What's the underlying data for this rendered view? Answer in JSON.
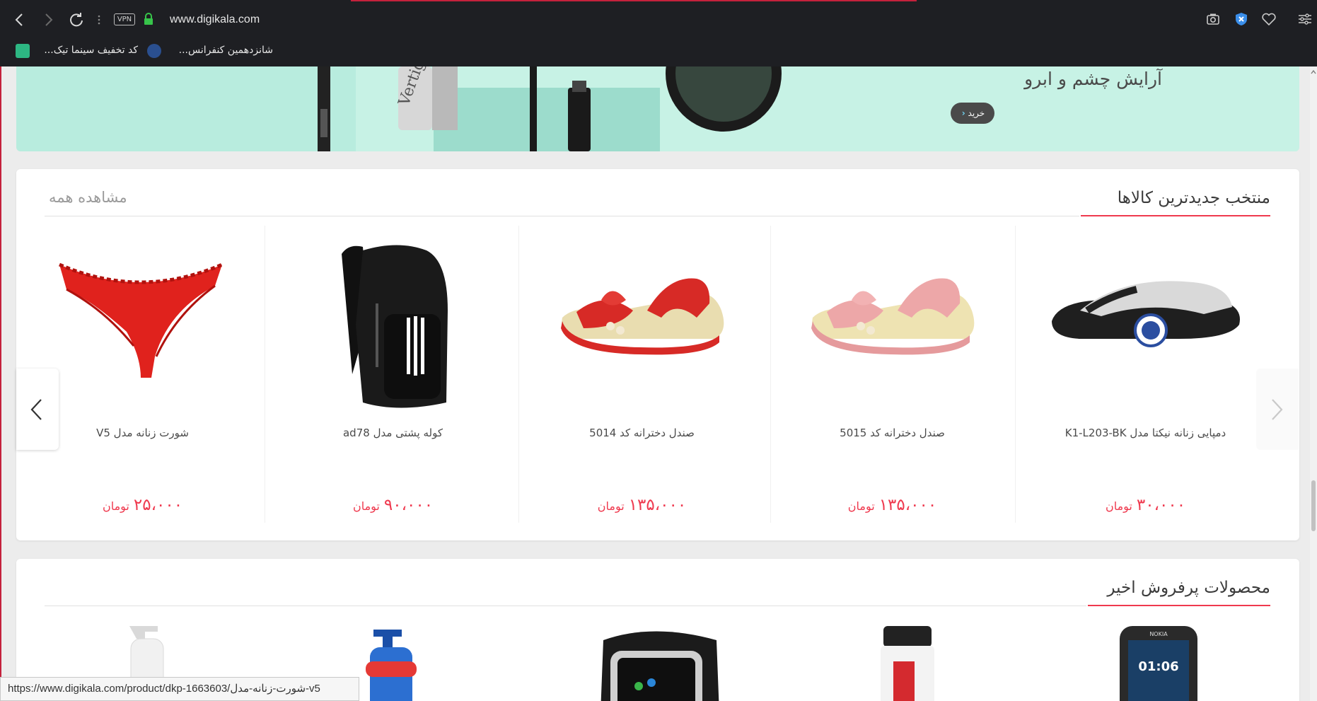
{
  "browser": {
    "url": "www.digikala.com",
    "vpn_label": "VPN",
    "bookmarks": [
      {
        "label": "شانزدهمین کنفرانس..."
      },
      {
        "label": "کد تخفیف سینما تیک..."
      }
    ],
    "icons": [
      "back-icon",
      "forward-icon",
      "reload-icon",
      "more-icon",
      "lock-icon",
      "camera-icon",
      "shield-icon",
      "heart-icon",
      "menu-icon"
    ]
  },
  "banner": {
    "title": "آرایش چشم و ابرو",
    "buy_label": "خرید"
  },
  "newest": {
    "title": "منتخب جدیدترین کالاها",
    "see_all": "مشاهده همه",
    "products": [
      {
        "name": "دمپایی زنانه نیکتا مدل K1-L203-BK",
        "price": "۳۰،۰۰۰",
        "currency": "تومان"
      },
      {
        "name": "صندل دخترانه کد 5015",
        "price": "۱۳۵،۰۰۰",
        "currency": "تومان"
      },
      {
        "name": "صندل دخترانه کد 5014",
        "price": "۱۳۵،۰۰۰",
        "currency": "تومان"
      },
      {
        "name": "کوله پشتی مدل ad78",
        "price": "۹۰،۰۰۰",
        "currency": "تومان"
      },
      {
        "name": "شورت زنانه مدل V5",
        "price": "۲۵،۰۰۰",
        "currency": "تومان"
      }
    ]
  },
  "bestsellers": {
    "title": "محصولات پرفروش اخیر",
    "phone_time": "01:06",
    "phone_brand": "NOKIA"
  },
  "status_bar": {
    "url": "https://www.digikala.com/product/dkp-1663603/شورت-زنانه-مدل-v5"
  },
  "colors": {
    "accent": "#ef394e",
    "banner_bg": "#b8ecde",
    "chrome_bg": "#1e1f23"
  }
}
